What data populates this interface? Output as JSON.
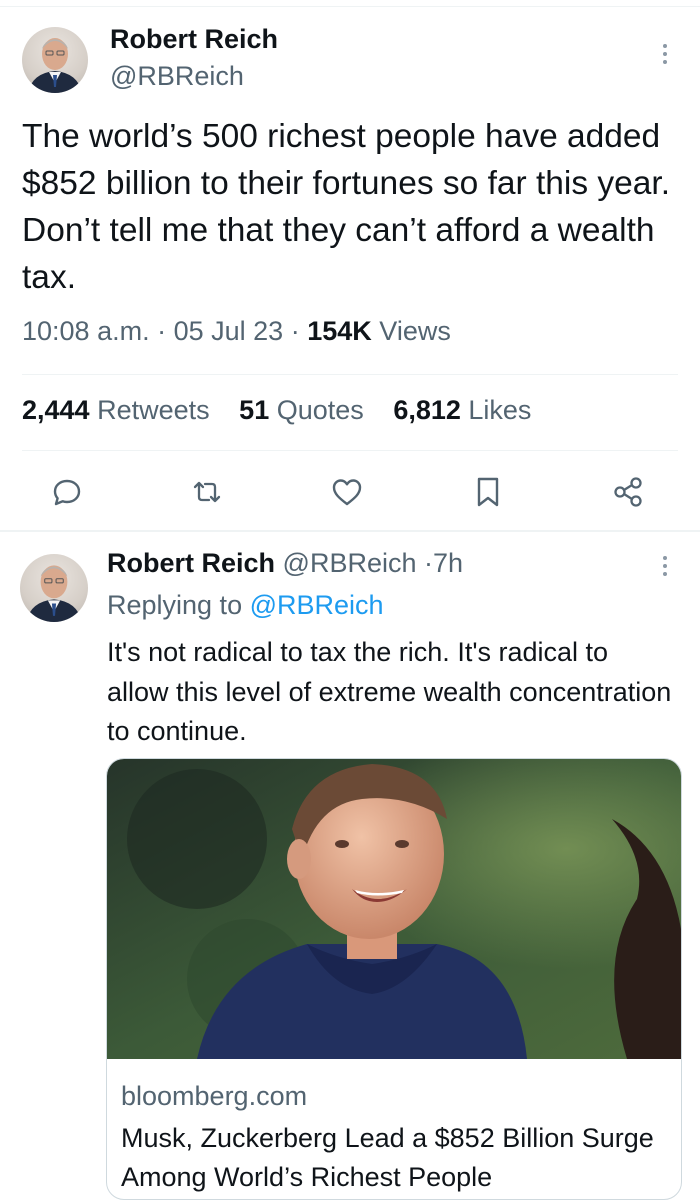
{
  "main_tweet": {
    "author_name": "Robert Reich",
    "author_handle": "@RBReich",
    "text": "The world’s 500 richest people have added $852 billion to their fortunes so far this year. Don’t tell me that they can’t afford a wealth tax.",
    "time": "10:08 a.m.",
    "date": "05 Jul 23",
    "separator": "·",
    "views_count": "154K",
    "views_label": "Views",
    "stats": {
      "retweets_count": "2,444",
      "retweets_label": "Retweets",
      "quotes_count": "51",
      "quotes_label": "Quotes",
      "likes_count": "6,812",
      "likes_label": "Likes"
    },
    "actions": [
      "reply-icon",
      "retweet-icon",
      "like-icon",
      "bookmark-icon",
      "share-icon"
    ]
  },
  "reply_tweet": {
    "author_name": "Robert Reich",
    "author_handle": "@RBReich",
    "separator": "·",
    "age": "7h",
    "replying_label": "Replying to",
    "replying_to": "@RBReich",
    "text": "It's not radical to tax the rich. It's radical to allow this level of extreme wealth concentration to continue.",
    "card": {
      "domain": "bloomberg.com",
      "title": "Musk, Zuckerberg Lead a $852 Billion Surge Among World’s Richest People"
    }
  },
  "colors": {
    "accent": "#1d9bf0",
    "text": "#0f1419",
    "secondary": "#536471",
    "divider": "#eff3f4"
  }
}
